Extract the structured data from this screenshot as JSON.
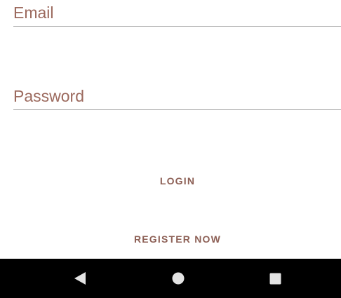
{
  "form": {
    "email_placeholder": "Email",
    "password_placeholder": "Password",
    "login_label": "LOGIN",
    "register_label": "REGISTER NOW"
  },
  "navigation_bar": {
    "buttons": [
      {
        "icon": "back-triangle-icon"
      },
      {
        "icon": "home-circle-icon"
      },
      {
        "icon": "recents-square-icon"
      }
    ]
  },
  "colors": {
    "text_accent": "#9c6a5e",
    "button_text": "#8d6056",
    "underline": "#a9a9a9",
    "nav_background": "#000000",
    "nav_icon": "#e3e3e3"
  }
}
